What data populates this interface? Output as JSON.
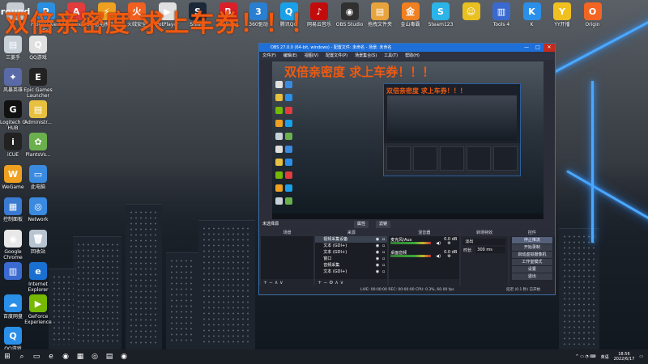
{
  "banner": "双倍亲密度 求上车券！！！",
  "desktop_icons_top": [
    {
      "label": "",
      "color": "#c7ccd2",
      "icon": "round"
    },
    {
      "label": "ProcessAlert\nPal",
      "color": "#2a8fe0",
      "icon": "P"
    },
    {
      "label": "AliGame\nPal",
      "color": "#e23c3c",
      "icon": "A"
    },
    {
      "label": "雷电模拟器",
      "color": "#f0a020",
      "icon": "⚡"
    },
    {
      "label": "火绒安全",
      "color": "#f06020",
      "icon": "火"
    },
    {
      "label": "PotPlayer",
      "color": "#e0e0e0",
      "icon": "▶"
    },
    {
      "label": "Steam",
      "color": "#1b2838",
      "icon": "S"
    },
    {
      "label": "BigBang",
      "color": "#d8202a",
      "icon": "B"
    },
    {
      "label": "360驱动",
      "color": "#2a7fd0",
      "icon": "3"
    },
    {
      "label": "腾讯QQ",
      "color": "#1aa0e8",
      "icon": "Q"
    },
    {
      "label": "网易云音乐",
      "color": "#c20c0c",
      "icon": "♪"
    },
    {
      "label": "OBS Studio",
      "color": "#303030",
      "icon": "◉"
    },
    {
      "label": "拖拽文件夹",
      "color": "#e8a33c",
      "icon": "▤"
    },
    {
      "label": "金山毒霸",
      "color": "#f08020",
      "icon": "金"
    },
    {
      "label": "Steam123",
      "color": "#2cb3e8",
      "icon": "S"
    },
    {
      "label": "",
      "color": "#e8c020",
      "icon": "☺"
    },
    {
      "label": "Tools 4",
      "color": "#3a6ad0",
      "icon": "▥"
    },
    {
      "label": "K",
      "color": "#2a8fe8",
      "icon": "K"
    },
    {
      "label": "YY开播",
      "color": "#f0c020",
      "icon": "Y"
    },
    {
      "label": "Origin",
      "color": "#f26522",
      "icon": "O"
    }
  ],
  "desktop_icons_left": [
    {
      "label": "三菱手",
      "color": "#c8d0d8",
      "icon": "▤"
    },
    {
      "label": "QQ游戏",
      "color": "#e0e0e0",
      "icon": "Q"
    },
    {
      "label": "风暴英雄",
      "color": "#5a6aa8",
      "icon": "✦"
    },
    {
      "label": "Epic Games\nLauncher",
      "color": "#222",
      "icon": "E"
    },
    {
      "label": "Logitech G\nHUB",
      "color": "#111",
      "icon": "G"
    },
    {
      "label": "Administr...",
      "color": "#e8c040",
      "icon": "▤"
    },
    {
      "label": "iCUE",
      "color": "#222",
      "icon": "i"
    },
    {
      "label": "PlantsVs...",
      "color": "#6ab04c",
      "icon": "✿"
    },
    {
      "label": "WeGame",
      "color": "#f0a020",
      "icon": "W"
    },
    {
      "label": "此电脑",
      "color": "#3a8ae0",
      "icon": "▭"
    },
    {
      "label": "控制面板",
      "color": "#3a7ad0",
      "icon": "▦"
    },
    {
      "label": "Network",
      "color": "#3a8ae0",
      "icon": "◎"
    },
    {
      "label": "Google\nChrome",
      "color": "#e8e8e8",
      "icon": "◉"
    },
    {
      "label": "回收站",
      "color": "#b8c4d0",
      "icon": "🗑"
    },
    {
      "label": "",
      "color": "#3a6ad0",
      "icon": "▥"
    },
    {
      "label": "Internet\nExplorer",
      "color": "#1a70d0",
      "icon": "e"
    },
    {
      "label": "百度网盘",
      "color": "#2a8fe8",
      "icon": "☁"
    },
    {
      "label": "GeForce\nExperience",
      "color": "#76b900",
      "icon": "▶"
    },
    {
      "label": "QQ游戏",
      "color": "#2a8fe8",
      "icon": "Q"
    }
  ],
  "obs": {
    "title": "OBS 27.0.0 (64-bit, windows) - 配置文件: 未命名 - 场景: 未命名",
    "menu": [
      "文件(F)",
      "编辑(E)",
      "视图(V)",
      "配置文件(P)",
      "场景集合(S)",
      "工具(T)",
      "帮助(H)"
    ],
    "source_bar": "未选择源",
    "source_bar_buttons": [
      "属性",
      "滤镜"
    ],
    "docks": {
      "scenes": {
        "title": "场景",
        "footer": "+ − ∧ ∨"
      },
      "sources": {
        "title": "来源",
        "items": [
          "视频采集设备",
          "文本 (GDI+)",
          "文本 (GDI+)",
          "窗口",
          "音频采集",
          "文本 (GDI+)"
        ],
        "footer": "+ − ⚙ ∧ ∨"
      },
      "mixer": {
        "title": "混音器",
        "channels": [
          {
            "name": "麦克风/Aux",
            "level": "0.0 dB"
          },
          {
            "name": "桌面音频",
            "level": "0.0 dB"
          }
        ]
      },
      "transitions": {
        "title": "转场特效",
        "type": "淡出",
        "duration_label": "时长",
        "duration": "300 ms"
      },
      "controls": {
        "title": "控件",
        "buttons": [
          "停止推流",
          "开始录制",
          "启动虚拟摄像机",
          "工作室模式",
          "设置",
          "退出"
        ]
      }
    },
    "status": "LIVE: 00:00:00   REC: 00:00:00   CPU: 0.3%, 60.00 fps",
    "status_right": "延迟 (0.1 秒) 已开始"
  },
  "taskbar": {
    "apps": [
      "⊞",
      "⌕",
      "▭",
      "e",
      "◉",
      "▦",
      "◎",
      "▤",
      "◉"
    ],
    "tray_lang": "英语",
    "time": "18:56",
    "date": "2022/6/17"
  }
}
